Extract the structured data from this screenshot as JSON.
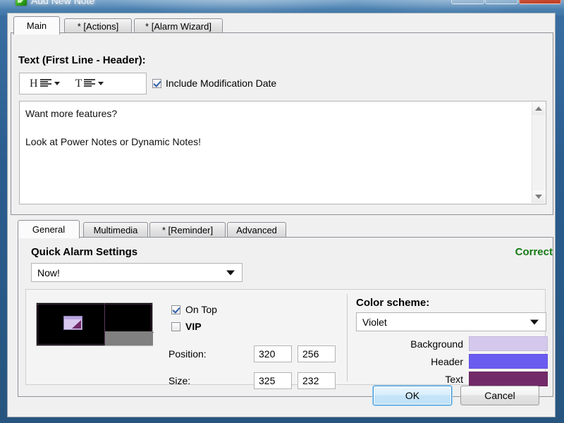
{
  "window": {
    "title": "Add New Note",
    "icon": "note-app-icon",
    "buttons": {
      "minimize": "minimize-icon",
      "maximize": "maximize-icon",
      "close": "close-icon"
    }
  },
  "outer_tabs": [
    {
      "label": "Main",
      "active": true
    },
    {
      "label": "* [Actions]",
      "active": false
    },
    {
      "label": "* [Alarm Wizard]",
      "active": false
    }
  ],
  "text_section": {
    "label": "Text (First Line - Header):",
    "toolbar": {
      "header_letter": "H",
      "header_align_icon": "align-left-icon",
      "header_dropdown_icon": "chevron-down-icon",
      "text_letter": "T",
      "text_align_icon": "align-left-icon",
      "text_dropdown_icon": "chevron-down-icon"
    },
    "include_modification_date": {
      "label": "Include Modification Date",
      "checked": true
    },
    "editor_text": "Want more features?\n\nLook at Power Notes or Dynamic Notes!",
    "scrollbar": {
      "up_icon": "scroll-up-arrow-icon",
      "down_icon": "scroll-down-arrow-icon"
    }
  },
  "inner_tabs": [
    {
      "label": "General",
      "active": true
    },
    {
      "label": "Multimedia",
      "active": false
    },
    {
      "label": "* [Reminder]",
      "active": false
    },
    {
      "label": "Advanced",
      "active": false
    }
  ],
  "general_tab": {
    "quick_alarm": {
      "title": "Quick Alarm Settings",
      "status": "Correct",
      "status_color": "#137a13",
      "selected": "Now!",
      "dropdown_icon": "chevron-down-icon"
    },
    "preview": {
      "name": "screen-position-preview"
    },
    "on_top": {
      "label": "On Top",
      "checked": true
    },
    "vip": {
      "label": "VIP",
      "checked": false
    },
    "position": {
      "label": "Position:",
      "x": "320",
      "y": "256"
    },
    "size": {
      "label": "Size:",
      "width": "325",
      "height": "232"
    },
    "color_scheme": {
      "label": "Color scheme:",
      "selected": "Violet",
      "dropdown_icon": "chevron-down-icon",
      "rows": [
        {
          "label": "Background",
          "color": "#d4c8ec"
        },
        {
          "label": "Header",
          "color": "#6b5cf0"
        },
        {
          "label": "Text",
          "color": "#722b68"
        }
      ]
    }
  },
  "footer": {
    "ok": "OK",
    "cancel": "Cancel"
  }
}
